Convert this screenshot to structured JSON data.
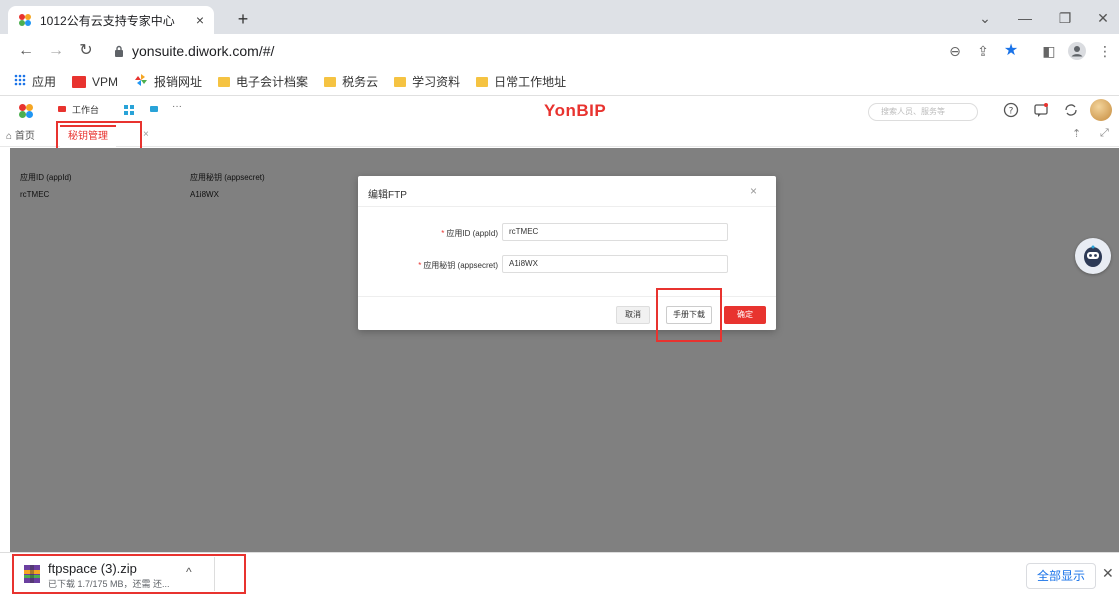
{
  "browser": {
    "tab_title": "1012公有云支持专家中心",
    "tab_close": "×",
    "new_tab": "+",
    "url": "yonsuite.diwork.com/#/",
    "win_min": "—",
    "win_restore": "❐",
    "win_close": "✕",
    "down_caret": "⌄"
  },
  "bookmarks": [
    {
      "label": "应用",
      "icon": "apps-grid-icon"
    },
    {
      "label": "VPM",
      "icon": "vpm-icon"
    },
    {
      "label": "报销网址",
      "icon": "pinwheel-icon"
    },
    {
      "label": "电子会计档案",
      "icon": "folder-icon"
    },
    {
      "label": "税务云",
      "icon": "folder-icon"
    },
    {
      "label": "学习资料",
      "icon": "folder-icon"
    },
    {
      "label": "日常工作地址",
      "icon": "folder-icon"
    }
  ],
  "app": {
    "logo_text": "YonBIP",
    "workbench_label": "工作台",
    "more": "···",
    "search_placeholder": "搜索人员、服务等",
    "home_tab": "首页",
    "active_tab": "秘钥管理",
    "active_tab_close": "×"
  },
  "table": {
    "headers": [
      "应用ID (appId)",
      "应用秘钥 (appsecret)"
    ],
    "row": [
      "rcTMEC",
      "A1i8WX"
    ]
  },
  "dialog": {
    "title": "编辑FTP",
    "close": "×",
    "fields": [
      {
        "label": "应用ID (appId)",
        "value": "rcTMEC"
      },
      {
        "label": "应用秘钥 (appsecret)",
        "value": "A1i8WX"
      }
    ],
    "required_mark": "*",
    "cancel_label": "取消",
    "manual_label": "手册下载",
    "ok_label": "确定"
  },
  "download": {
    "filename": "ftpspace (3).zip",
    "status": "已下载 1.7/175 MB，还需 还...",
    "chevron": "^",
    "show_all": "全部显示",
    "close": "✕"
  },
  "colors": {
    "brand_red": "#e8332f",
    "link_blue": "#1a73e8",
    "folder_yellow": "#f5c342"
  }
}
